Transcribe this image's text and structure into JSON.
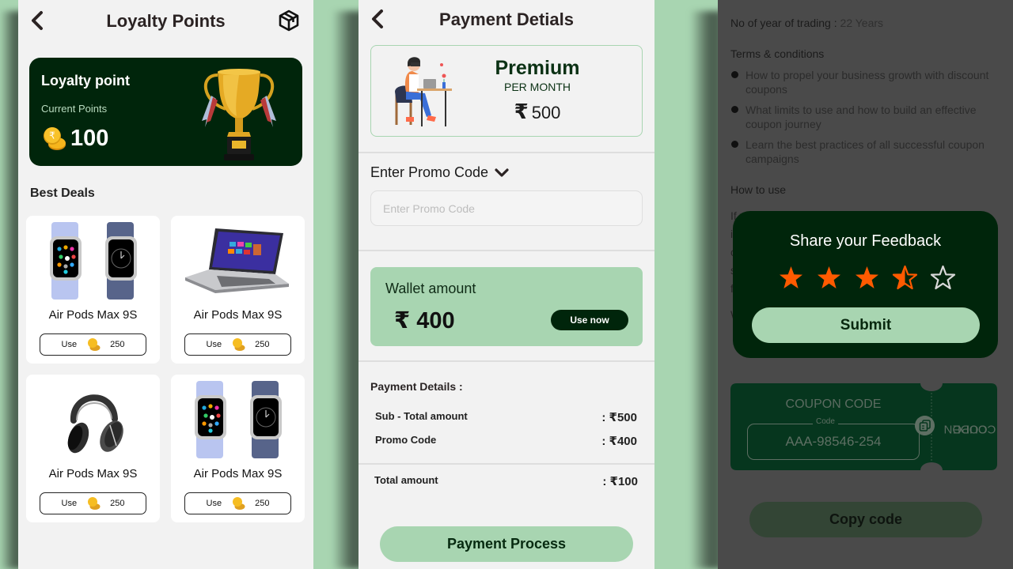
{
  "colors": {
    "accent_dark": "#00250b",
    "accent_light": "#a8d5b1",
    "star_filled": "#ff5a00",
    "star_empty": "#d9d9d9"
  },
  "loyalty": {
    "title": "Loyalty Points",
    "card": {
      "title": "Loyalty point",
      "subtitle": "Current Points",
      "points": "100"
    },
    "best_deals_title": "Best Deals",
    "deals": [
      {
        "name": "Air Pods Max 9S",
        "image": "smartwatch-pair",
        "use_label": "Use",
        "cost": "250"
      },
      {
        "name": "Air Pods Max 9S",
        "image": "laptop",
        "use_label": "Use",
        "cost": "250"
      },
      {
        "name": "Air Pods Max 9S",
        "image": "headphones",
        "use_label": "Use",
        "cost": "250"
      },
      {
        "name": "Air Pods Max 9S",
        "image": "smartwatch-pair",
        "use_label": "Use",
        "cost": "250"
      }
    ]
  },
  "payment": {
    "title": "Payment Detials",
    "plan": {
      "name": "Premium",
      "period": "PER MONTH",
      "currency": "₹",
      "price": "500"
    },
    "promo": {
      "label": "Enter Promo Code",
      "placeholder": "Enter Promo Code",
      "value": ""
    },
    "wallet": {
      "title": "Wallet amount",
      "amount": "₹ 400",
      "button": "Use now"
    },
    "details": {
      "title": "Payment Details :",
      "rows": [
        {
          "label": "Sub - Total amount",
          "value": ": ₹500"
        },
        {
          "label": "Promo Code",
          "value": ": ₹400"
        }
      ],
      "total": {
        "label": "Total amount",
        "value": ": ₹100"
      }
    },
    "button": "Payment Process"
  },
  "coupon": {
    "trading_label": "No of year of trading :",
    "trading_value": "22 Years",
    "terms_title": "Terms & conditions",
    "terms": [
      "How to propel your business growth with discount coupons",
      "What limits to use and how to build an effective coupon journey",
      "Learn the best practices of all successful coupon campaigns"
    ],
    "how_to_use_title": "How to use",
    "how_to_use_partial": [
      "If y",
      "i",
      "c",
      "s",
      "f"
    ],
    "partial_heading": "W",
    "ticket": {
      "title": "COUPON CODE",
      "code_label": "Code",
      "code": "AAA-98546-254",
      "side_text_line1": "COUPON",
      "side_text_line2": "CODE"
    },
    "copy_button": "Copy code"
  },
  "feedback": {
    "title": "Share your Feedback",
    "rating": 3.5,
    "max_rating": 5,
    "submit": "Submit"
  }
}
